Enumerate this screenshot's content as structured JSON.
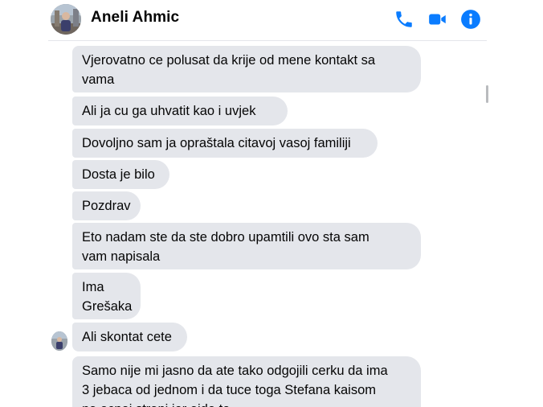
{
  "header": {
    "contact_name": "Aneli Ahmic",
    "icons": [
      "phone-icon",
      "video-camera-icon",
      "info-icon"
    ],
    "accent_color": "#0a7cff"
  },
  "messages": [
    {
      "text": "Vjerovatno ce polusat da krije od mene kontakt sa\nvama"
    },
    {
      "text": "Ali ja cu ga uhvatit kao i uvjek"
    },
    {
      "text": "Dovoljno sam ja opraštala citavoj vasoj familiji"
    },
    {
      "text": "Dosta je bilo"
    },
    {
      "text": "Pozdrav"
    },
    {
      "text": "Eto nadam ste da ste dobro upamtili ovo sta sam\nvam napisala"
    },
    {
      "text": "Ima\nGrešaka"
    },
    {
      "text": "Ali skontat cete"
    },
    {
      "text": "Samo nije mi jasno da ate tako odgojili cerku da ima\n3 jebaca od jednom i da tuce toga Stefana kaisom\nna ocnoj strani jer ajde to ... "
    }
  ],
  "bubble_color": "#e4e6eb"
}
